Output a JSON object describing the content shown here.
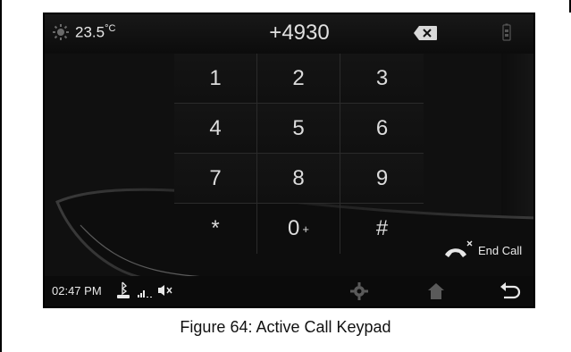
{
  "status": {
    "temperature": "23.5",
    "temperature_unit": "°C",
    "time": "02:47 PM"
  },
  "dial": {
    "number": "+4930"
  },
  "keypad": {
    "keys": [
      {
        "digit": "1",
        "sub": ""
      },
      {
        "digit": "2",
        "sub": ""
      },
      {
        "digit": "3",
        "sub": ""
      },
      {
        "digit": "4",
        "sub": ""
      },
      {
        "digit": "5",
        "sub": ""
      },
      {
        "digit": "6",
        "sub": ""
      },
      {
        "digit": "7",
        "sub": ""
      },
      {
        "digit": "8",
        "sub": ""
      },
      {
        "digit": "9",
        "sub": ""
      },
      {
        "digit": "*",
        "sub": ""
      },
      {
        "digit": "0",
        "sub": "+"
      },
      {
        "digit": "#",
        "sub": ""
      }
    ]
  },
  "actions": {
    "end_call_label": "End Call"
  },
  "icons": {
    "weather": "sun-icon",
    "backspace": "backspace-icon",
    "battery": "battery-icon",
    "bluetooth": "bluetooth-phone-icon",
    "signal": "signal-icon",
    "mute": "mute-icon",
    "settings": "gear-icon",
    "home": "home-icon",
    "back": "back-icon",
    "end_call": "end-call-icon"
  },
  "caption": "Figure 64: Active Call Keypad"
}
